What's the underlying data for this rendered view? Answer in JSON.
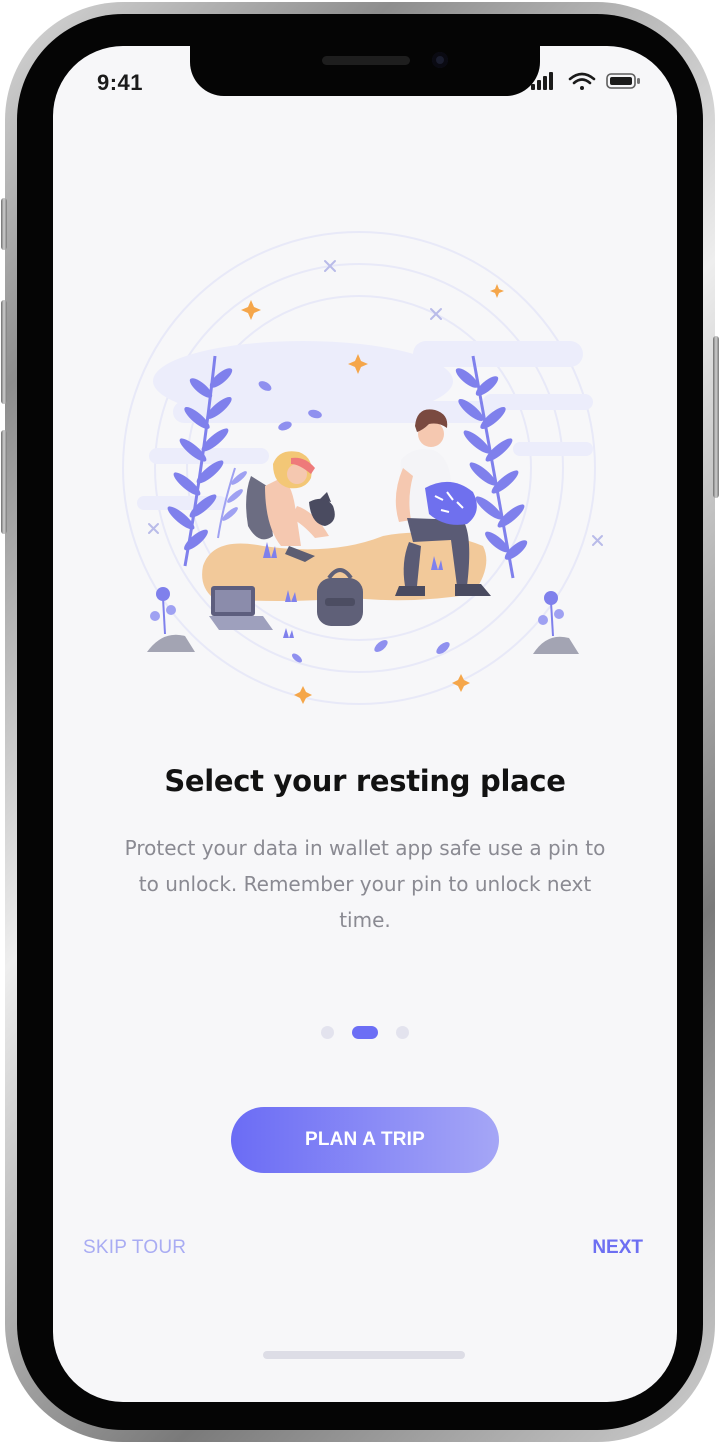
{
  "status_bar": {
    "time": "9:41",
    "icons": [
      "cellular-signal-icon",
      "wifi-icon",
      "battery-icon"
    ]
  },
  "illustration": {
    "name": "resting-place-illustration",
    "colors": {
      "accent": "#6c6ef5",
      "sand": "#f2c99a",
      "star": "#f5a64a",
      "ring": "#e6e7f8"
    }
  },
  "onboarding": {
    "title": "Select your resting place",
    "description": "Protect your data in wallet app safe use a pin to to unlock. Remember your pin to unlock next time.",
    "pagination": {
      "total": 3,
      "active_index": 1
    }
  },
  "actions": {
    "primary": "PLAN A TRIP",
    "skip": "SKIP TOUR",
    "next": "NEXT"
  },
  "colors": {
    "accent": "#6c6ef5",
    "accent_light": "#a9acf3",
    "title": "#121212",
    "body_text": "#8a8a92",
    "background": "#f7f7f9"
  }
}
